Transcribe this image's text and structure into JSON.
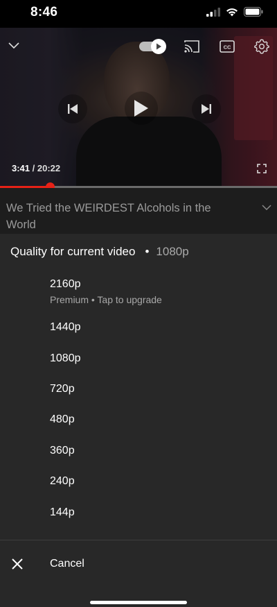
{
  "status_bar": {
    "time": "8:46"
  },
  "player": {
    "current_time": "3:41",
    "separator": " / ",
    "duration": "20:22",
    "progress_fraction": 0.181
  },
  "video": {
    "title": "We Tried the WEIRDEST Alcohols in the World"
  },
  "quality_sheet": {
    "header_label": "Quality for current video",
    "header_dot": "•",
    "current_quality": "1080p",
    "options": [
      {
        "label": "2160p",
        "sub": "Premium • Tap to upgrade"
      },
      {
        "label": "1440p"
      },
      {
        "label": "1080p"
      },
      {
        "label": "720p"
      },
      {
        "label": "480p"
      },
      {
        "label": "360p"
      },
      {
        "label": "240p"
      },
      {
        "label": "144p"
      }
    ],
    "cancel_label": "Cancel"
  },
  "icons": {
    "collapse": "chevron-down-icon",
    "autoplay": "autoplay-toggle-icon",
    "cast": "cast-icon",
    "captions": "captions-icon",
    "settings": "gear-icon",
    "previous": "skip-previous-icon",
    "play": "play-icon",
    "next": "skip-next-icon",
    "fullscreen": "fullscreen-icon",
    "close": "close-icon"
  },
  "colors": {
    "accent": "#e62117",
    "sheet_bg": "#282828",
    "title_bg": "#1d1d1d"
  }
}
